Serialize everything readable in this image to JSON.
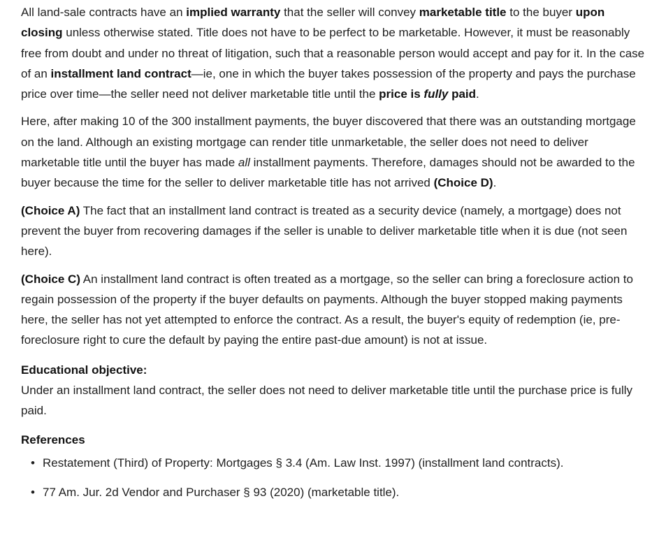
{
  "p1": {
    "s1": "All land-sale contracts have an ",
    "b1": "implied warranty",
    "s2": " that the seller will convey ",
    "b2": "marketable title",
    "s3": " to the buyer ",
    "b3": "upon closing",
    "s4": " unless otherwise stated.  Title does not have to be perfect to be marketable.  However, it must be reasonably free from doubt and under no threat of litigation, such that a reasonable person would accept and pay for it.  In the case of an ",
    "b4": "installment land contract",
    "s5": "—ie, one in which the buyer takes possession of the property and pays the purchase price over time—the seller need not deliver marketable title until the ",
    "b5a": "price is ",
    "b5i": "fully",
    "b5b": " paid",
    "s6": "."
  },
  "p2": {
    "s1": "Here, after making 10 of the 300 installment payments, the buyer discovered that there was an outstanding mortgage on the land.  Although an existing mortgage can render title unmarketable, the seller does not need to deliver marketable title until the buyer has made ",
    "i1": "all",
    "s2": " installment payments.  Therefore, damages should not be awarded to the buyer because the time for the seller to deliver marketable title has not arrived ",
    "b1": "(Choice D)",
    "s3": "."
  },
  "p3": {
    "b1": "(Choice A)",
    "s1": "  The fact that an installment land contract is treated as a security device (namely, a mortgage) does not prevent the buyer from recovering damages if the seller is unable to deliver marketable title when it is due (not seen here)."
  },
  "p4": {
    "b1": "(Choice C)",
    "s1": "  An installment land contract is often treated as a mortgage, so the seller can bring a foreclosure action to regain possession of the property if the buyer defaults on payments.  Although the buyer stopped making payments here, the seller has not yet attempted to enforce the contract.  As a result, the buyer's equity of redemption (ie, pre-foreclosure right to cure the default by paying the entire past-due amount) is not at issue."
  },
  "objective": {
    "heading": "Educational objective:",
    "text": "Under an installment land contract, the seller does not need to deliver marketable title until the purchase price is fully paid."
  },
  "references": {
    "heading": "References",
    "bullet": "•",
    "items": [
      "Restatement (Third) of Property: Mortgages § 3.4 (Am. Law Inst. 1997) (installment land contracts).",
      "77 Am. Jur. 2d Vendor and Purchaser § 93 (2020) (marketable title)."
    ]
  }
}
